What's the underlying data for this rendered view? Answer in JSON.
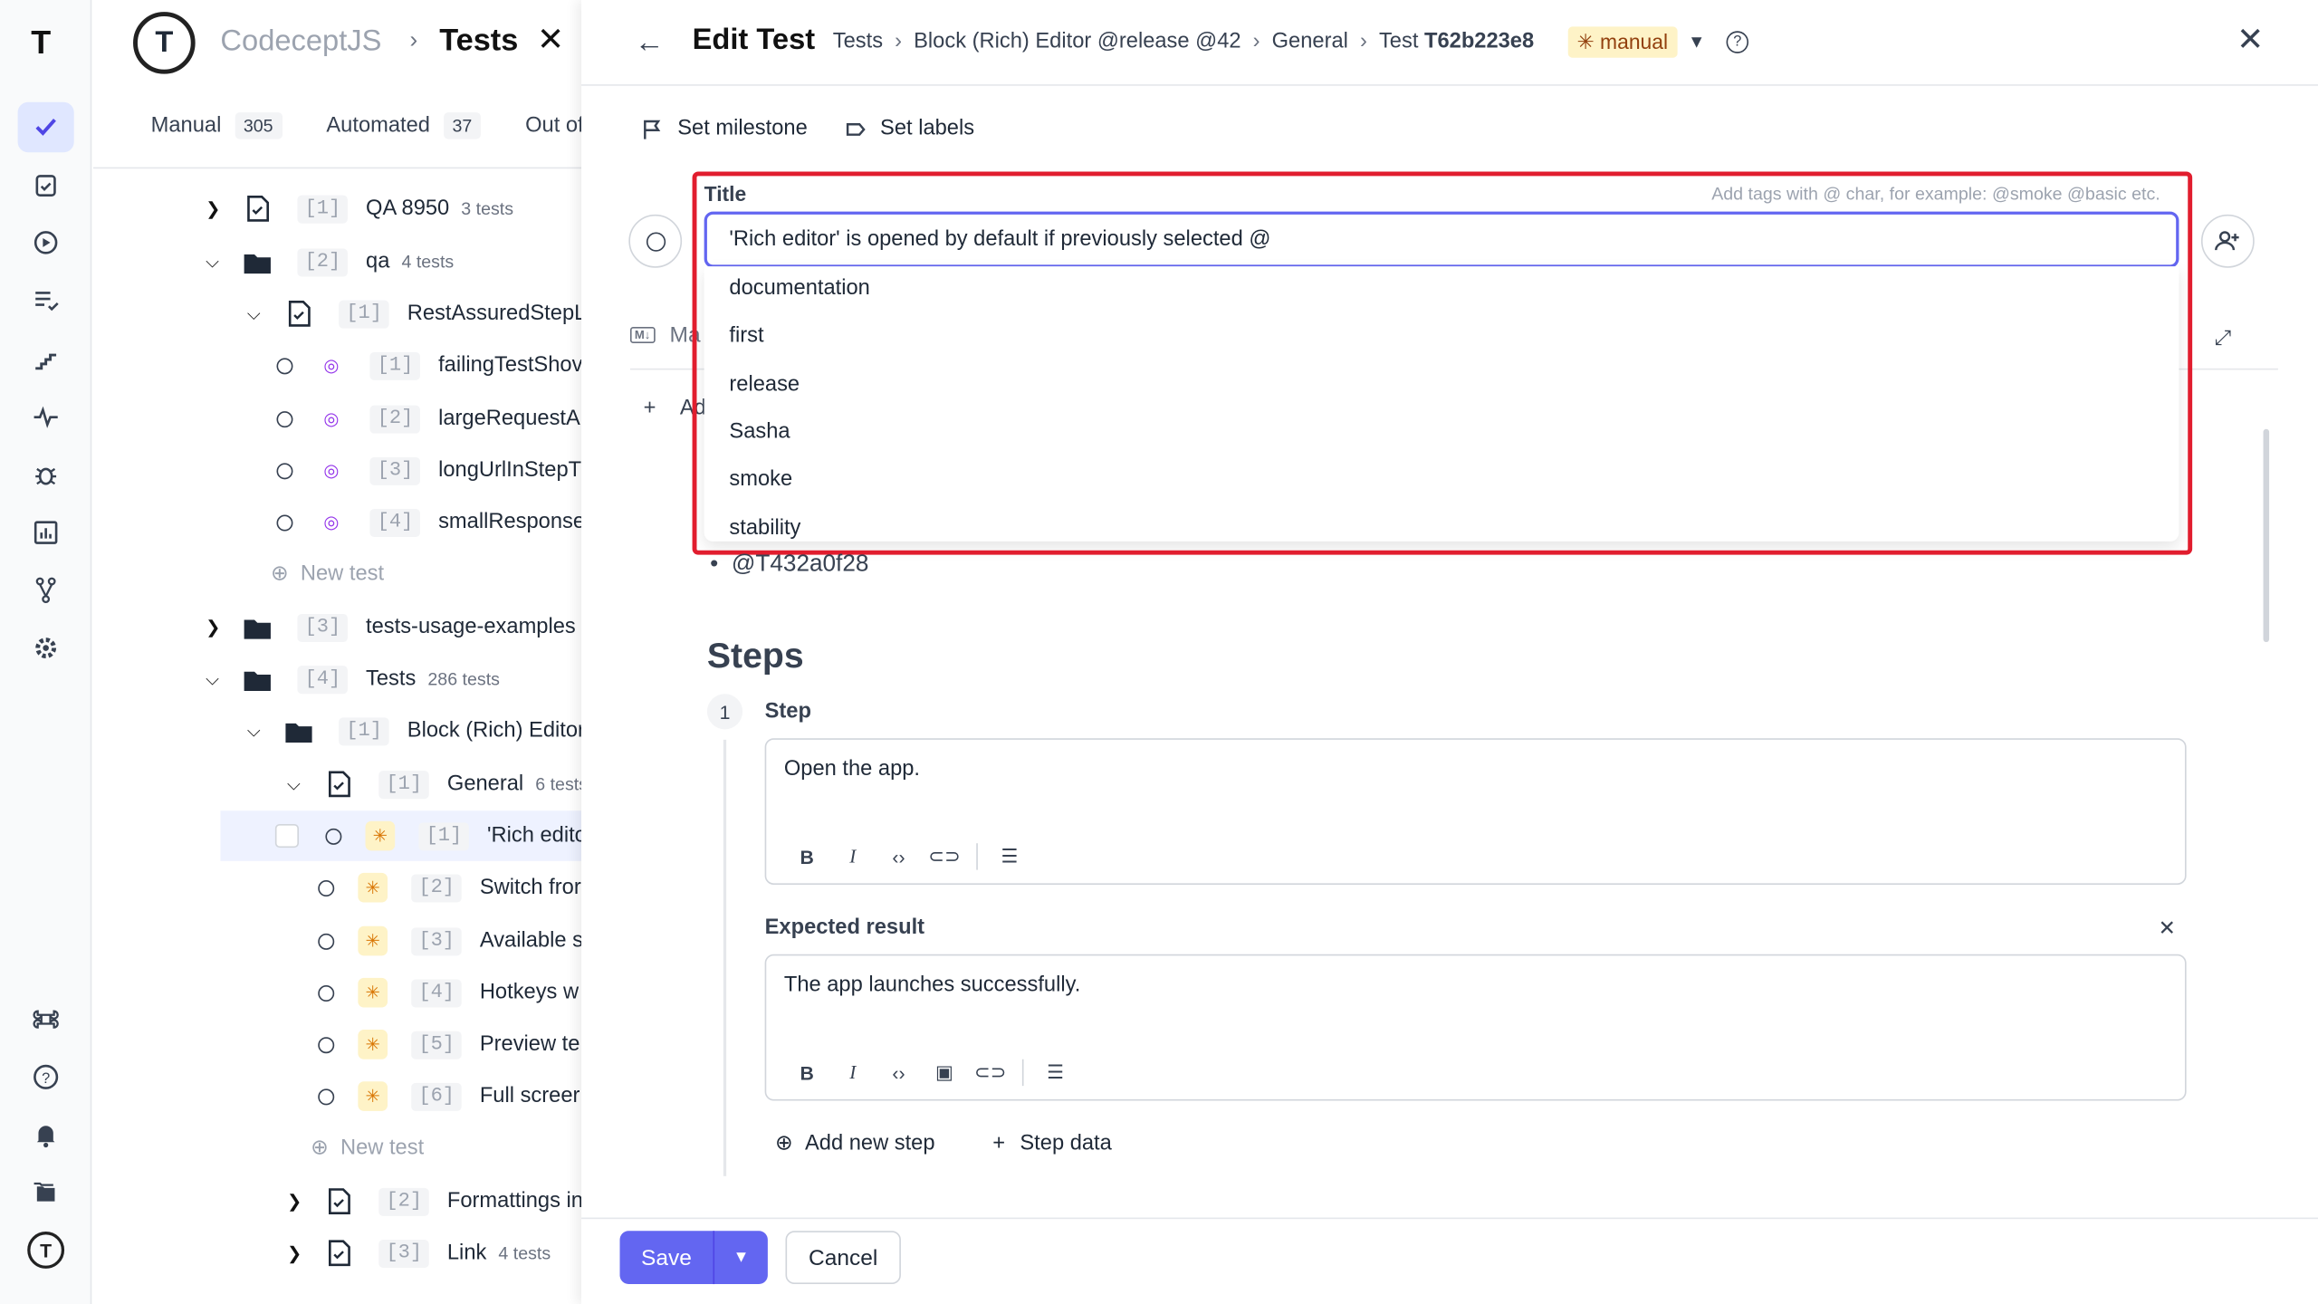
{
  "rail": {
    "logo": "T",
    "icons": [
      "check-icon",
      "clipboard-icon",
      "play-icon",
      "list-check-icon",
      "steps-icon",
      "pulse-icon",
      "bug-icon",
      "chart-icon",
      "branch-icon",
      "gear-icon",
      "command-icon",
      "help-icon",
      "bell-icon",
      "folders-icon",
      "user-logo-icon"
    ]
  },
  "project": {
    "name": "CodeceptJS",
    "sep": "›",
    "section": "Tests",
    "close": "✕"
  },
  "tabs": [
    {
      "label": "Manual",
      "count": "305"
    },
    {
      "label": "Automated",
      "count": "37"
    },
    {
      "label": "Out of",
      "count": ""
    }
  ],
  "tree": [
    {
      "type": "suite",
      "num": "[1]",
      "name": "QA 8950",
      "count": "3 tests"
    },
    {
      "type": "folder",
      "num": "[2]",
      "name": "qa",
      "count": "4 tests"
    },
    {
      "type": "suite",
      "num": "[1]",
      "name": "RestAssuredStepLo",
      "count": ""
    },
    {
      "type": "auto",
      "num": "[1]",
      "name": "failingTestShov"
    },
    {
      "type": "auto",
      "num": "[2]",
      "name": "largeRequestA"
    },
    {
      "type": "auto",
      "num": "[3]",
      "name": "longUrlInStepT"
    },
    {
      "type": "auto",
      "num": "[4]",
      "name": "smallResponse"
    },
    {
      "type": "new",
      "name": "New test"
    },
    {
      "type": "folder",
      "num": "[3]",
      "name": "tests-usage-examples",
      "count": ""
    },
    {
      "type": "folder",
      "num": "[4]",
      "name": "Tests",
      "count": "286 tests"
    },
    {
      "type": "folder",
      "num": "[1]",
      "name": "Block (Rich) Editor",
      "count": ""
    },
    {
      "type": "suite",
      "num": "[1]",
      "name": "General",
      "count": "6 tests"
    },
    {
      "type": "manual",
      "num": "[1]",
      "name": "'Rich edito"
    },
    {
      "type": "manual",
      "num": "[2]",
      "name": "Switch fror"
    },
    {
      "type": "manual",
      "num": "[3]",
      "name": "Available s"
    },
    {
      "type": "manual",
      "num": "[4]",
      "name": "Hotkeys w"
    },
    {
      "type": "manual",
      "num": "[5]",
      "name": "Preview te"
    },
    {
      "type": "manual",
      "num": "[6]",
      "name": "Full screer"
    },
    {
      "type": "new",
      "name": "New test"
    },
    {
      "type": "suite",
      "num": "[2]",
      "name": "Formattings in",
      "count": ""
    },
    {
      "type": "suite",
      "num": "[3]",
      "name": "Link",
      "count": "4 tests"
    }
  ],
  "edit": {
    "back": "←",
    "heading": "Edit Test",
    "crumbs": [
      "Tests",
      "Block (Rich) Editor @release @42",
      "General"
    ],
    "test_prefix": "Test",
    "test_id": "T62b223e8",
    "crumb_sep": "›",
    "badge": "manual",
    "help": "?",
    "close": "✕",
    "set_milestone": "Set milestone",
    "set_labels": "Set labels",
    "title_label": "Title",
    "title_hint": "Add tags with @ char, for example: @smoke @basic etc.",
    "title_value": "'Rich editor' is opened by default if previously selected @",
    "tag_options": [
      "documentation",
      "first",
      "release",
      "Sasha",
      "smoke",
      "stability"
    ],
    "md_label": "Ma",
    "add_label": "Ad",
    "bullet": "@T432a0f28",
    "steps_heading": "Steps",
    "step_number": "1",
    "step_label": "Step",
    "step_text": "Open the app.",
    "expected_label": "Expected result",
    "expected_text": "The app launches successfully.",
    "add_step": "Add new step",
    "step_data": "Step data",
    "save": "Save",
    "cancel": "Cancel"
  },
  "colors": {
    "accent": "#6366f1",
    "highlight": "#e11d2e",
    "manual_badge": "#fef3c7"
  }
}
